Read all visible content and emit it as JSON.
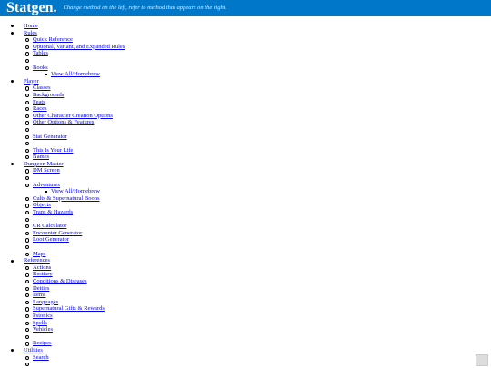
{
  "header": {
    "brand": "Statgen.",
    "tagline": "Change method on the left, refer to method that appears on the right."
  },
  "nav": {
    "home": "Home",
    "rules": {
      "label": "Rules",
      "items": [
        "Quick Reference",
        "Optional, Variant, and Expanded Rules",
        "Tables"
      ],
      "books": "Books",
      "books_sub": "View All/Homebrew"
    },
    "player": {
      "label": "Player",
      "items": [
        "Classes",
        "Backgrounds",
        "Feats",
        "Races",
        "Other Character Creation Options",
        "Other Options & Features"
      ],
      "stat_generator": "Stat Generator",
      "extra": [
        "This Is Your Life",
        "Names"
      ]
    },
    "dm": {
      "label": "Dungeon Master",
      "dm_screen": "DM Screen",
      "adventures": "Adventures",
      "adventures_sub": "View All/Homebrew",
      "items": [
        "Cults & Supernatural Boons",
        "Objects",
        "Traps & Hazards"
      ],
      "tools": [
        "CR Calculator",
        "Encounter Generator",
        "Loot Generator"
      ],
      "maps": "Maps"
    },
    "references": {
      "label": "References",
      "items": [
        "Actions",
        "Bestiary",
        "Conditions & Diseases",
        "Deities",
        "Items",
        "Languages",
        "Supernatural Gifts & Rewards",
        "Psionics",
        "Spells",
        "Vehicles"
      ],
      "recipes": "Recipes"
    },
    "utilities": {
      "label": "Utilities",
      "search": "Search"
    }
  }
}
